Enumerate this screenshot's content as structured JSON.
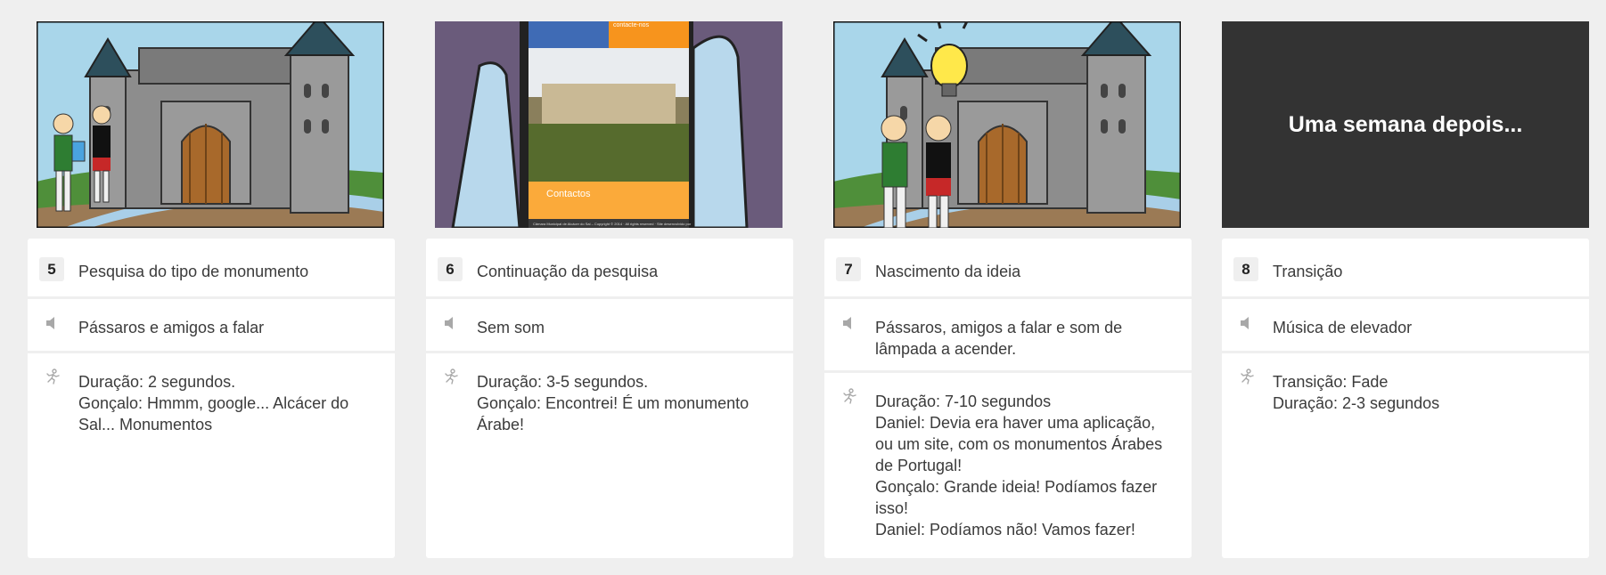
{
  "scenes": [
    {
      "number": "5",
      "title": "Pesquisa do tipo de monumento",
      "sound": "Pássaros e amigos a falar",
      "action": "Duração: 2 segundos.\nGonçalo: Hmmm, google... Alcácer do Sal... Monumentos"
    },
    {
      "number": "6",
      "title": "Continuação da pesquisa",
      "sound": "Sem som",
      "action": "Duração: 3-5 segundos.\nGonçalo: Encontrei! É um monumento Árabe!",
      "phone_screen": {
        "header_text": "contacte-nos",
        "section_label": "Contactos",
        "footer_text": "Câmara Municipal de Alcácer do Sal – Copyright © 2014 · All rights reserved · Site desenvolvido por tetotums.pt"
      }
    },
    {
      "number": "7",
      "title": "Nascimento da ideia",
      "sound": "Pássaros, amigos a falar e som de lâmpada a acender.",
      "action": "Duração: 7-10 segundos\nDaniel: Devia era haver uma aplicação, ou um site, com os monumentos Árabes de Portugal!\nGonçalo: Grande ideia! Podíamos fazer isso!\nDaniel: Podíamos não! Vamos fazer!"
    },
    {
      "number": "8",
      "title": "Transição",
      "sound": "Música de elevador",
      "action": "Transição: Fade\nDuração: 2-3 segundos",
      "transition_text": "Uma semana depois..."
    }
  ],
  "icons": {
    "sound": "speaker-icon",
    "action": "running-figure-icon"
  },
  "colors": {
    "background": "#efefef",
    "card": "#ffffff",
    "transition_panel": "#333333",
    "sky": "#a9d6ea",
    "grass": "#4f8f3a",
    "orange": "#f7941d"
  }
}
